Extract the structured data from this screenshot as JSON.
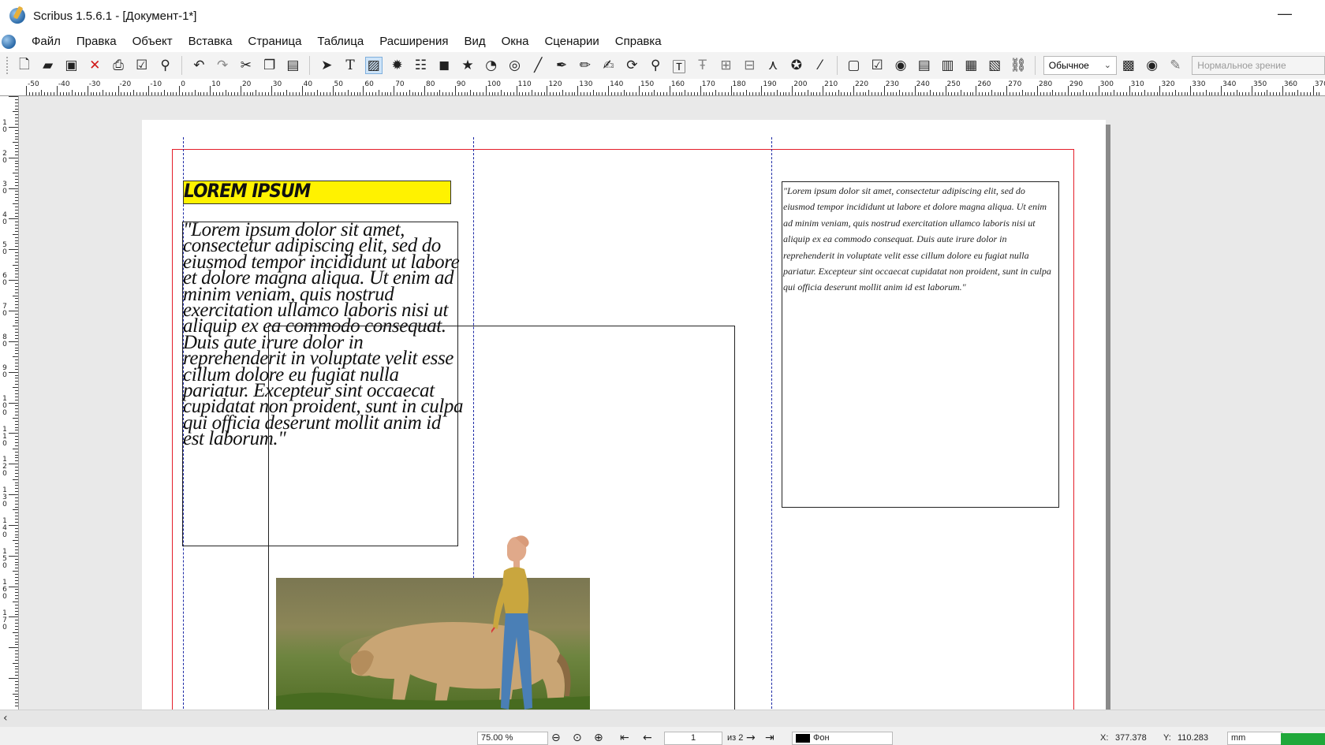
{
  "window": {
    "title": "Scribus 1.5.6.1 - [Документ-1*]",
    "minimize_glyph": "—"
  },
  "menu": [
    "Файл",
    "Правка",
    "Объект",
    "Вставка",
    "Страница",
    "Таблица",
    "Расширения",
    "Вид",
    "Окна",
    "Сценарии",
    "Справка"
  ],
  "toolbar": {
    "mode_select": "Обычное",
    "vision_placeholder": "Нормальное зрение"
  },
  "ruler": {
    "h_labels": [
      "-50",
      "-40",
      "-30",
      "-20",
      "-10",
      "0",
      "10",
      "20",
      "30",
      "40",
      "50",
      "60",
      "70",
      "80",
      "90",
      "100",
      "110",
      "120",
      "130",
      "140",
      "150",
      "160",
      "170",
      "180",
      "190",
      "200",
      "210",
      "220",
      "230",
      "240",
      "250",
      "260",
      "270",
      "280",
      "290",
      "300",
      "310",
      "320",
      "330",
      "340",
      "350",
      "360",
      "370"
    ],
    "v_labels": [
      "1 0",
      "2 0",
      "3 0",
      "4 0",
      "5 0",
      "6 0",
      "7 0",
      "8 0",
      "9 0",
      "1 0 0",
      "1 1 0",
      "1 2 0",
      "1 3 0",
      "1 4 0",
      "1 5 0",
      "1 6 0",
      "1 7 0"
    ]
  },
  "document": {
    "heading": "LOREM IPSUM",
    "body_large": "\"Lorem ipsum dolor sit amet, consectetur adipiscing elit, sed do eiusmod tempor incididunt ut labore et dolore magna aliqua. Ut enim ad minim veniam, quis nostrud exercitation ullamco laboris nisi ut aliquip ex ea commodo consequat. Duis aute irure dolor in reprehenderit in voluptate velit esse cillum dolore eu fugiat nulla pariatur. Excepteur sint occaecat cupidatat non proident, sunt in culpa qui officia deserunt mollit anim id est laborum.\"",
    "body_small": "\"Lorem ipsum dolor sit amet, consectetur adipiscing elit, sed do eiusmod tempor incididunt ut labore et dolore magna aliqua. Ut enim ad minim veniam, quis nostrud exercitation ullamco laboris nisi ut aliquip ex ea commodo consequat. Duis aute irure dolor in reprehenderit in voluptate velit esse cillum dolore eu fugiat nulla pariatur. Excepteur sint occaecat cupidatat non proident, sunt in culpa qui officia deserunt mollit anim id est laborum.\""
  },
  "status": {
    "zoom": "75.00 %",
    "page_number": "1",
    "page_of": "из 2",
    "layer": "Фон",
    "x_label": "X:",
    "x_value": "377.378",
    "y_label": "Y:",
    "y_value": "110.283",
    "unit": "mm"
  },
  "colors": {
    "margin": "#e41e2a",
    "guide": "#1d2aa6",
    "heading_bg": "#fff200",
    "accent": "#1fa83a"
  }
}
